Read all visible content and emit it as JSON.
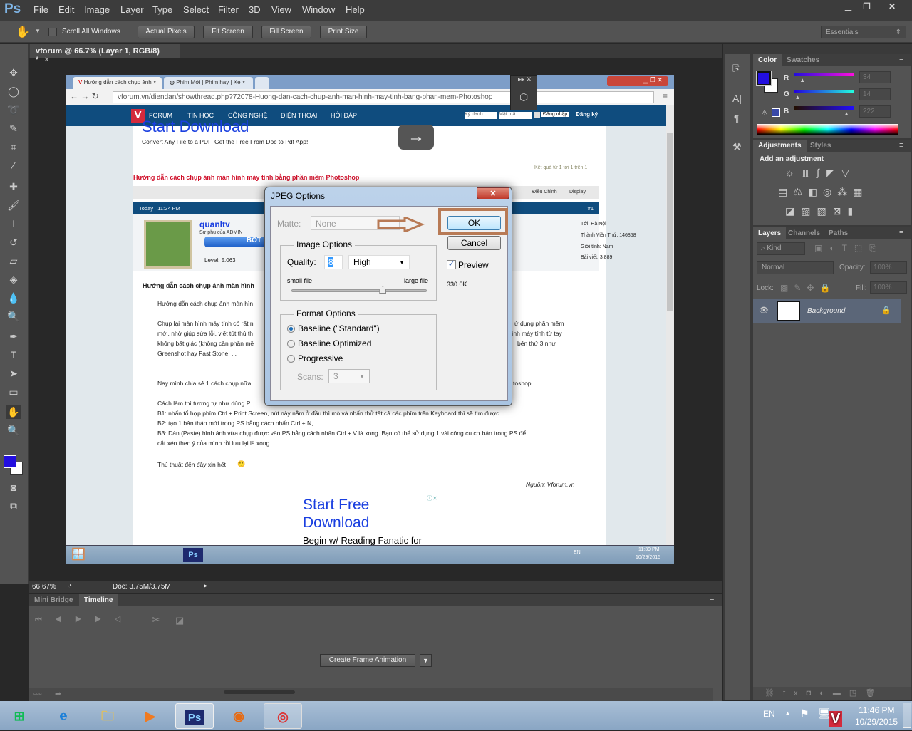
{
  "app": {
    "logo": "Ps",
    "menu": [
      "File",
      "Edit",
      "Image",
      "Layer",
      "Type",
      "Select",
      "Filter",
      "3D",
      "View",
      "Window",
      "Help"
    ],
    "window_controls": [
      "minimize",
      "restore",
      "close"
    ]
  },
  "options": {
    "scroll_all": "Scroll All Windows",
    "buttons": [
      "Actual Pixels",
      "Fit Screen",
      "Fill Screen",
      "Print Size"
    ],
    "workspace": "Essentials"
  },
  "document": {
    "tab": "vforum @ 66.7% (Layer 1, RGB/8) *",
    "zoom": "66.67%",
    "doc_size": "Doc: 3.75M/3.75M"
  },
  "browser": {
    "tabs": [
      "Hướng dẫn cách chụp ảnh",
      "Phim Mới | Phim hay | Xe"
    ],
    "url": "vforum.vn/diendan/showthread.php?72078-Huong-dan-cach-chup-anh-man-hinh-may-tinh-bang-phan-mem-Photoshop",
    "nav": [
      "FORUM",
      "TIN HỌC",
      "CÔNG NGHỆ",
      "ĐIỆN THOẠI",
      "HỎI ĐÁP"
    ],
    "login": {
      "user_placeholder": "Ký danh",
      "pass_placeholder": "Mật mã",
      "login": "Đăng nhập",
      "register": "Đăng ký"
    },
    "ad_top": {
      "title": "Start Download",
      "text": "Convert Any File to a PDF. Get the Free From Doc to Pdf App!"
    },
    "thread_title": "Hướng dẫn cách chụp ảnh màn hình máy tính bằng phần mềm Photoshop",
    "results": "Kết quả từ 1 tới 1 trên 1",
    "tools": [
      "Điều Chỉnh",
      "Display"
    ],
    "post": {
      "date": "Today",
      "time": "11:24 PM",
      "num": "#1",
      "user": "quanltv",
      "rank": "Sư phụ của ADMIN",
      "badge": "BOT",
      "level": "Level: 5.063",
      "info": [
        "Tới: Hà Nội",
        "Thành Viên Thứ: 146858",
        "Giới tính: Nam",
        "Bài viết: 3.889"
      ],
      "heading": "Hướng dẫn cách chụp ảnh màn hình",
      "lines": [
        "Hướng dẫn cách chụp ảnh màn hìn",
        "Chụp lại màn hình máy tính có rất n",
        "mới, nhờ giúp sửa lỗi, viết tút thủ th",
        "không bất giác (không cần phần mề",
        "Greenshot hay Fast Stone, ...",
        "Nay mình chia sẻ 1 cách chụp nữa",
        "Cách làm thì tương tự như dùng P",
        "B1: nhấn tổ hợp phím Ctrl + Print Screen, nút này nằm ở đầu thì mò và nhấn thử tất cả các phím trên Keyboard thì sẽ tìm được",
        "B2: tạo 1 bản tháo mới trong PS bằng cách nhấn Ctrl + N,",
        "B3: Dán (Paste) hình ảnh vừa chụp được vào PS bằng cách nhấn Ctrl + V là xong. Bạn có thể sử dụng 1 vài công cụ cơ bản trong PS để",
        "cắt xén theo ý của mình rồi lưu lại là xong",
        "Thủ thuật đến đây xin hết"
      ],
      "right_lines": [
        "ử dụng phần mềm",
        "ình máy tính từ tay",
        "bên thứ 3 như",
        "toshop."
      ],
      "source": "Nguồn: Vforum.vn"
    },
    "ad_bottom": {
      "title1": "Start Free",
      "title2": "Download",
      "text": "Begin w/ Reading Fanatic for"
    },
    "tray": {
      "lang": "EN",
      "time": "11:39 PM",
      "date": "10/29/2015"
    }
  },
  "dialog": {
    "title": "JPEG Options",
    "matte_label": "Matte:",
    "matte_value": "None",
    "image_options": "Image Options",
    "quality_label": "Quality:",
    "quality_value": "8",
    "quality_preset": "High",
    "small_file": "small file",
    "large_file": "large file",
    "quality_fraction": 0.67,
    "format_options": "Format Options",
    "formats": [
      "Baseline (\"Standard\")",
      "Baseline Optimized",
      "Progressive"
    ],
    "selected_format": 0,
    "scans_label": "Scans:",
    "scans_value": "3",
    "ok": "OK",
    "cancel": "Cancel",
    "preview": "Preview",
    "preview_checked": true,
    "size": "330.0K",
    "highlight_color": "#b87a55"
  },
  "panels": {
    "color": {
      "tabs": [
        "Color",
        "Swatches"
      ],
      "r": "34",
      "g": "14",
      "b": "222",
      "labels": [
        "R",
        "G",
        "B"
      ],
      "foreground": "#220ede",
      "background": "#ffffff"
    },
    "adjustments": {
      "tabs": [
        "Adjustments",
        "Styles"
      ],
      "heading": "Add an adjustment"
    },
    "layers": {
      "tabs": [
        "Layers",
        "Channels",
        "Paths"
      ],
      "filter": "Kind",
      "blend": "Normal",
      "opacity_label": "Opacity:",
      "opacity": "100%",
      "lock_label": "Lock:",
      "fill_label": "Fill:",
      "fill": "100%",
      "layer_name": "Background"
    }
  },
  "timeline": {
    "tabs": [
      "Mini Bridge",
      "Timeline"
    ],
    "create": "Create Frame Animation"
  },
  "taskbar": {
    "lang": "EN",
    "time": "11:46 PM",
    "date": "10/29/2015",
    "watermark": "Vforum.vn"
  }
}
